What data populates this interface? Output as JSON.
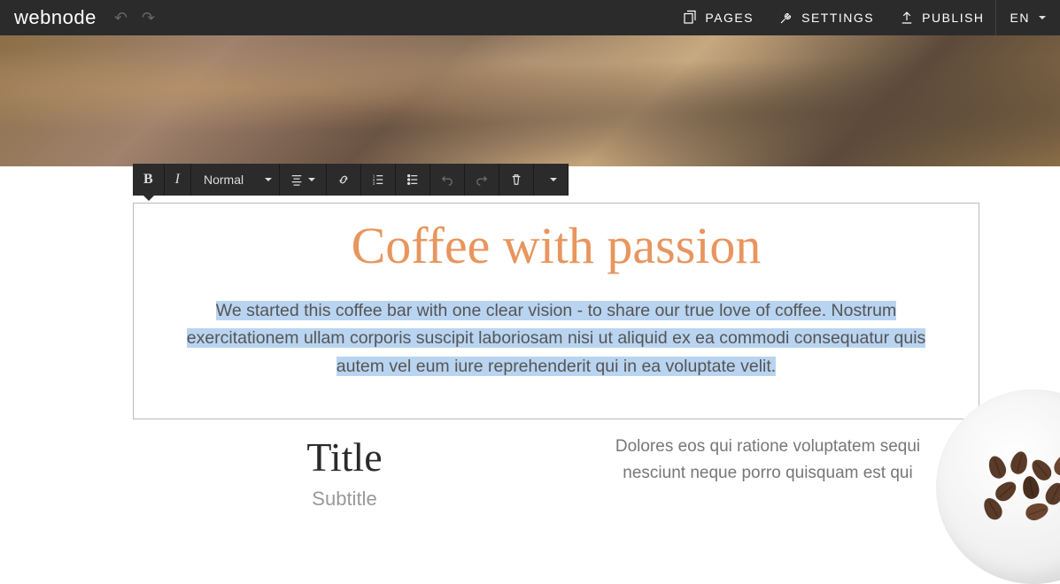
{
  "logo": "webnode",
  "topnav": {
    "pages": "PAGES",
    "settings": "SETTINGS",
    "publish": "PUBLISH",
    "lang": "EN"
  },
  "toolbar": {
    "format_label": "Normal"
  },
  "editor": {
    "heading": "Coffee with passion",
    "body": "We started this coffee bar with one clear vision - to share our true love of coffee. Nostrum exercitationem ullam corporis suscipit laboriosam nisi ut aliquid ex ea commodi consequatur quis autem vel eum iure reprehenderit qui in ea voluptate velit."
  },
  "columns": {
    "left": {
      "title": "Title",
      "subtitle": "Subtitle"
    },
    "right": {
      "text": "Dolores eos qui ratione voluptatem sequi nesciunt neque porro quisquam est qui"
    }
  }
}
